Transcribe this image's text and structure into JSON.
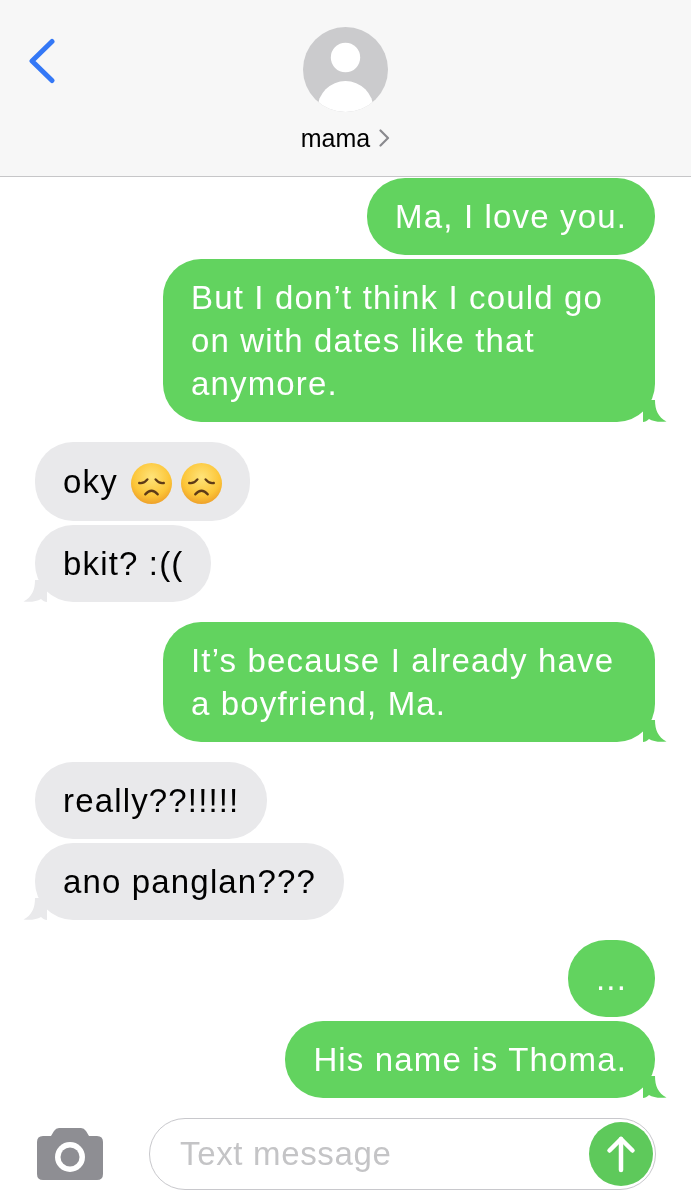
{
  "header": {
    "contact": {
      "name": "mama"
    }
  },
  "messages": [
    {
      "kind": "sent",
      "text": "Ma, I love you.",
      "tail": false
    },
    {
      "kind": "sent",
      "text": "But I don’t think I could go on with dates like that anymore.",
      "tail": true
    },
    {
      "kind": "received",
      "text": "oky",
      "emoji": [
        {
          "kind": "disappointed"
        },
        {
          "kind": "disappointed"
        }
      ],
      "tail": false
    },
    {
      "kind": "received",
      "text": "bkit? :((",
      "tail": true
    },
    {
      "kind": "sent",
      "text": "It’s because I already have a boyfriend, Ma.",
      "tail": true
    },
    {
      "kind": "received",
      "text": "really??!!!!!",
      "tail": false
    },
    {
      "kind": "received",
      "text": "ano panglan???",
      "tail": true
    },
    {
      "kind": "sent",
      "text": "...",
      "tail": false
    },
    {
      "kind": "sent",
      "text": "His name is Thoma.",
      "tail": true
    }
  ],
  "composer": {
    "placeholder": "Text message"
  }
}
